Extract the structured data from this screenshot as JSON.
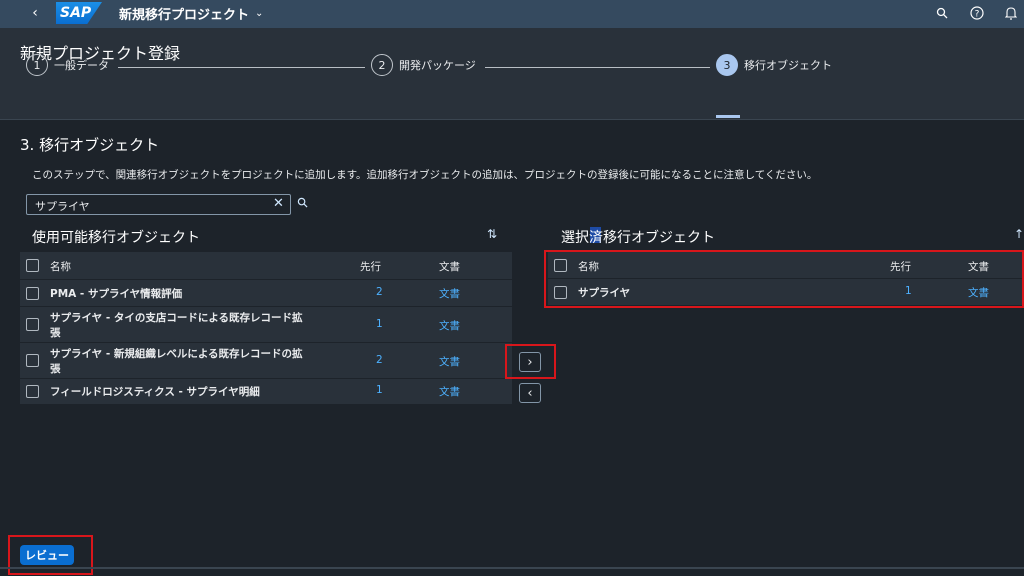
{
  "shell": {
    "back": "‹",
    "logo": "SAP",
    "title": "新規移行プロジェクト",
    "title_chevron": "⌄",
    "icons": [
      "search-icon",
      "help-icon",
      "bell-icon"
    ]
  },
  "page_title": "新規プロジェクト登録",
  "steps": [
    {
      "number": "1",
      "label": "一般データ"
    },
    {
      "number": "2",
      "label": "開発パッケージ"
    },
    {
      "number": "3",
      "label": "移行オブジェクト"
    }
  ],
  "section_title": "3. 移行オブジェクト",
  "info_text": "このステップで、関連移行オブジェクトをプロジェクトに追加します。追加移行オブジェクトの追加は、プロジェクトの登録後に可能になることに注意してください。",
  "search": {
    "value": "サプライヤ",
    "clear": "✕",
    "search_glyph": "⚲"
  },
  "available": {
    "title": "使用可能移行オブジェクト",
    "sort_glyph": "⇅",
    "columns": {
      "name": "名称",
      "predecessor": "先行",
      "docs": "文書"
    },
    "rows": [
      {
        "name": "PMA - サプライヤ情報評価",
        "name2": "",
        "predecessor": "2",
        "docs": "文書"
      },
      {
        "name": "サプライヤ - タイの支店コードによる既存レコード拡",
        "name2": "張",
        "predecessor": "1",
        "docs": "文書"
      },
      {
        "name": "サプライヤ - 新規組織レベルによる既存レコードの拡",
        "name2": "張",
        "predecessor": "2",
        "docs": "文書"
      },
      {
        "name": "フィールドロジスティクス - サプライヤ明細",
        "name2": "",
        "predecessor": "1",
        "docs": "文書"
      }
    ]
  },
  "selected": {
    "title": "選択済移行オブジェクト",
    "sort_glyph": "↑",
    "columns": {
      "name": "名称",
      "predecessor": "先行",
      "docs": "文書"
    },
    "rows": [
      {
        "name": "サプライヤ",
        "predecessor": "1",
        "docs": "文書"
      }
    ]
  },
  "move_right": "›",
  "move_left": "‹",
  "review_button": "レビュー",
  "colors": {
    "accent": "#0a6ed1",
    "highlight": "#d8161b",
    "link": "#4db1ff"
  }
}
